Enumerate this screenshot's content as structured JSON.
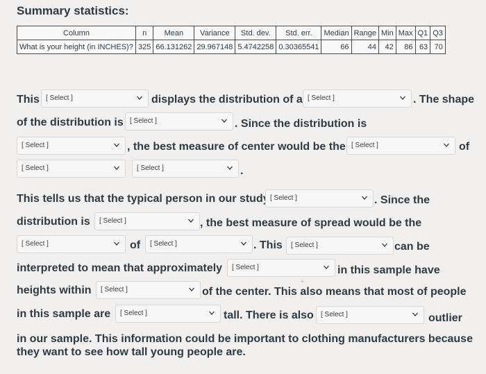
{
  "title": "Summary statistics:",
  "table": {
    "headers": [
      "Column",
      "n",
      "Mean",
      "Variance",
      "Std. dev.",
      "Std. err.",
      "Median",
      "Range",
      "Min",
      "Max",
      "Q1",
      "Q3"
    ],
    "row": [
      "What is your height (in INCHES)?",
      "325",
      "66.131262",
      "29.967148",
      "5.4742258",
      "0.30365541",
      "66",
      "44",
      "42",
      "86",
      "63",
      "70"
    ]
  },
  "text": {
    "t1": "This",
    "t2": "displays the distribution of a",
    "t3": ". The shape",
    "t4": "of the distribution is",
    "t5": ". Since the distribution is",
    "t6": ", the best measure of center would be the",
    "t7": "of",
    "t8": ".",
    "t9": "This tells us that the typical person in our study",
    "t10": ". Since the",
    "t11": "distribution is",
    "t12": ", the best measure of spread would be the",
    "t13": "of",
    "t14": ". This",
    "t15": "can be",
    "t16": "interpreted to mean that approximately",
    "t17": "in this sample have",
    "t18": "heights within",
    "t19": "of the center. This also means that most of people",
    "t20": "in this sample are",
    "t21": "tall. There is also",
    "t22": "outlier",
    "t23": "in our sample. This information could be important to clothing manufacturers because",
    "t24": "they want to see how tall young people are."
  },
  "select_placeholder": "[ Select ]",
  "chevron_icon": "chevron-down-icon",
  "plus_glyph": "+"
}
